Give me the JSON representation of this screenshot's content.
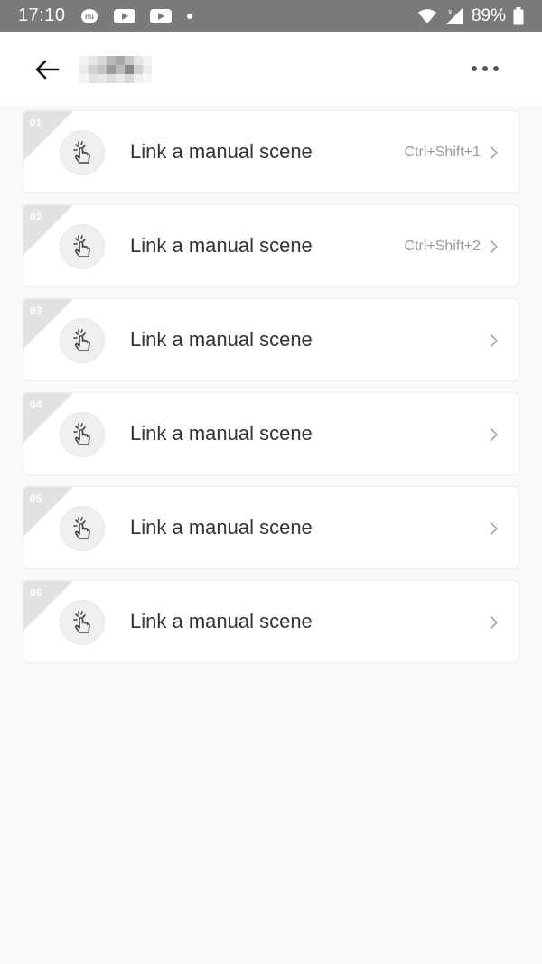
{
  "status_bar": {
    "time": "17:10",
    "battery": "89%",
    "icons": [
      "nu-badge-icon",
      "youtube-icon",
      "youtube-icon",
      "dot-icon",
      "wifi-icon",
      "signal-icon",
      "battery-icon"
    ]
  },
  "app_bar": {
    "title_blurred": true,
    "back_icon": "arrow-left-icon",
    "menu_icon": "more-horizontal-icon"
  },
  "items": [
    {
      "num": "01",
      "label": "Link a manual scene",
      "shortcut": "Ctrl+Shift+1"
    },
    {
      "num": "02",
      "label": "Link a manual scene",
      "shortcut": "Ctrl+Shift+2"
    },
    {
      "num": "03",
      "label": "Link a manual scene",
      "shortcut": ""
    },
    {
      "num": "04",
      "label": "Link a manual scene",
      "shortcut": ""
    },
    {
      "num": "05",
      "label": "Link a manual scene",
      "shortcut": ""
    },
    {
      "num": "06",
      "label": "Link a manual scene",
      "shortcut": ""
    }
  ],
  "colors": {
    "status_bar_bg": "#7a7a7a",
    "page_bg": "#f8f8f8",
    "card_bg": "#ffffff",
    "corner_tag": "#e2e2e2",
    "label_text": "#333333",
    "shortcut_text": "#9a9a9a"
  }
}
